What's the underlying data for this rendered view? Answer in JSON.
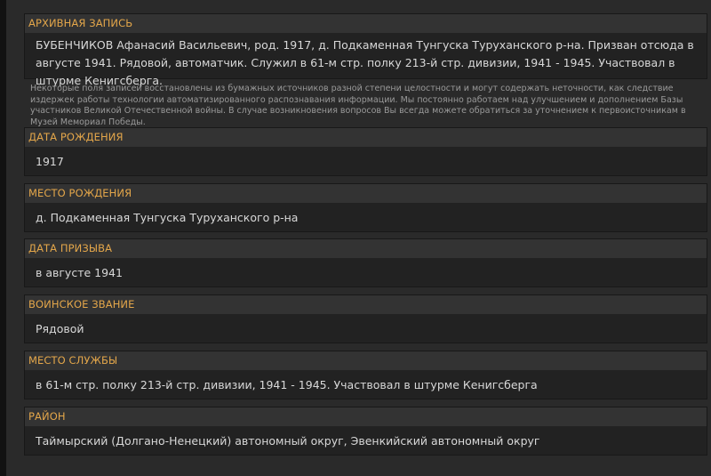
{
  "archive": {
    "header": "АРХИВНАЯ ЗАПИСЬ",
    "text": "БУБЕНЧИКОВ Афанасий Васильевич, род. 1917, д. Подкаменная Тунгуска Туруханского р-на. Призван отсюда в августе 1941. Рядовой, автоматчик. Служил в 61-м стр. полку 213-й стр. дивизии, 1941 - 1945. Участвовал в штурме Кенигсберга."
  },
  "notice": "Некоторые поля записей восстановлены из бумажных источников разной степени целостности и могут содержать неточности, как следствие издержек работы технологии автоматизированного распознавания информации. Мы постоянно работаем над улучшением и дополнением Базы участников Великой Отечественной войны. В случае возникновения вопросов Вы всегда можете обратиться за уточнением к первоисточникам в Музей Мемориал Победы.",
  "fields": [
    {
      "label": "ДАТА РОЖДЕНИЯ",
      "value": "1917"
    },
    {
      "label": "МЕСТО РОЖДЕНИЯ",
      "value": "д. Подкаменная Тунгуска Туруханского р-на"
    },
    {
      "label": "ДАТА ПРИЗЫВА",
      "value": "в августе 1941"
    },
    {
      "label": "ВОИНСКОЕ ЗВАНИЕ",
      "value": "Рядовой"
    },
    {
      "label": "МЕСТО СЛУЖБЫ",
      "value": "в 61-м стр. полку 213-й стр. дивизии, 1941 - 1945. Участвовал в штурме Кенигсберга"
    },
    {
      "label": "РАЙОН",
      "value": "Таймырский (Долгано-Ненецкий) автономный округ, Эвенкийский автономный округ"
    }
  ]
}
